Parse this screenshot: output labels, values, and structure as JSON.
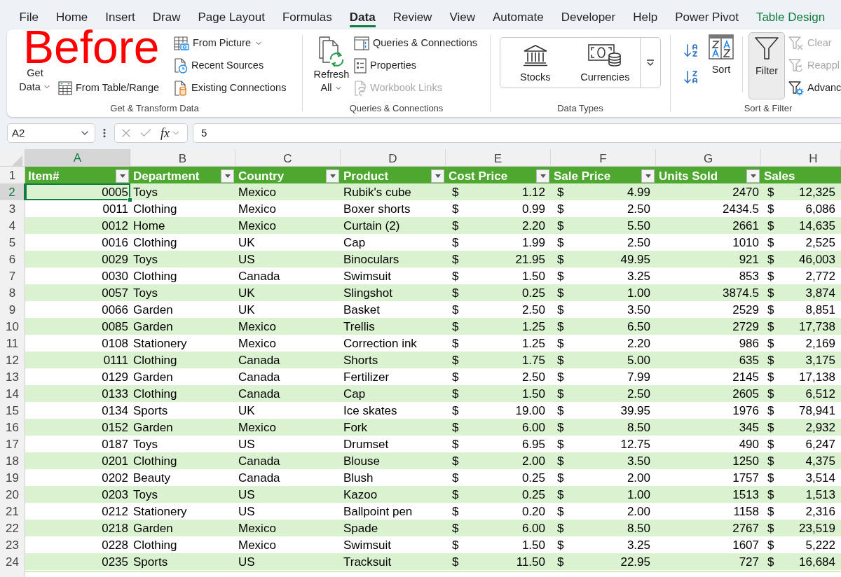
{
  "annotation": {
    "text": "Before"
  },
  "menu_tabs": [
    {
      "label": "File",
      "selected": false,
      "kind": "standard"
    },
    {
      "label": "Home",
      "selected": false,
      "kind": "standard"
    },
    {
      "label": "Insert",
      "selected": false,
      "kind": "standard"
    },
    {
      "label": "Draw",
      "selected": false,
      "kind": "standard"
    },
    {
      "label": "Page Layout",
      "selected": false,
      "kind": "standard"
    },
    {
      "label": "Formulas",
      "selected": false,
      "kind": "standard"
    },
    {
      "label": "Data",
      "selected": true,
      "kind": "standard"
    },
    {
      "label": "Review",
      "selected": false,
      "kind": "standard"
    },
    {
      "label": "View",
      "selected": false,
      "kind": "standard"
    },
    {
      "label": "Automate",
      "selected": false,
      "kind": "standard"
    },
    {
      "label": "Developer",
      "selected": false,
      "kind": "standard"
    },
    {
      "label": "Help",
      "selected": false,
      "kind": "standard"
    },
    {
      "label": "Power Pivot",
      "selected": false,
      "kind": "standard"
    },
    {
      "label": "Table Design",
      "selected": false,
      "kind": "contextual"
    }
  ],
  "ribbon": {
    "get_transform": {
      "label": "Get & Transform Data",
      "get_data": {
        "lines": [
          "Get",
          "Data"
        ]
      },
      "from_table_range": {
        "label": "From Table/Range"
      },
      "from_picture": {
        "label": "From Picture"
      },
      "recent_sources": {
        "label": "Recent Sources"
      },
      "existing_connections": {
        "label": "Existing Connections"
      }
    },
    "queries_connections": {
      "label": "Queries & Connections",
      "refresh_all": {
        "lines": [
          "Refresh",
          "All"
        ]
      },
      "items": [
        {
          "label": "Queries & Connections",
          "disabled": false
        },
        {
          "label": "Properties",
          "disabled": false
        },
        {
          "label": "Workbook Links",
          "disabled": true
        }
      ]
    },
    "data_types": {
      "label": "Data Types",
      "items": [
        {
          "label": "Stocks"
        },
        {
          "label": "Currencies"
        }
      ]
    },
    "sort_filter": {
      "label": "Sort & Filter",
      "sort": {
        "label": "Sort"
      },
      "filter": {
        "label": "Filter",
        "selected": true
      },
      "items": [
        {
          "label": "Clear",
          "disabled": true
        },
        {
          "label": "Reappl",
          "disabled": true
        },
        {
          "label": "Advanc",
          "disabled": false
        }
      ]
    }
  },
  "formula_bar": {
    "name_box": "A2",
    "function_button": "fx",
    "formula": "5"
  },
  "sheet": {
    "header_row_number": "1",
    "columns": [
      {
        "letter": "A",
        "selected": true,
        "heading": "Item#",
        "kind": "number",
        "filter": true
      },
      {
        "letter": "B",
        "selected": false,
        "heading": "Department",
        "kind": "text",
        "filter": true
      },
      {
        "letter": "C",
        "selected": false,
        "heading": "Country",
        "kind": "text",
        "filter": true
      },
      {
        "letter": "D",
        "selected": false,
        "heading": "Product",
        "kind": "text",
        "filter": true
      },
      {
        "letter": "E",
        "selected": false,
        "heading": "Cost Price",
        "kind": "currency",
        "filter": true
      },
      {
        "letter": "F",
        "selected": false,
        "heading": "Sale Price",
        "kind": "currency",
        "filter": true
      },
      {
        "letter": "G",
        "selected": false,
        "heading": "Units Sold",
        "kind": "number",
        "filter": true
      },
      {
        "letter": "H",
        "selected": false,
        "heading": "Sales",
        "kind": "currency"
      }
    ],
    "rows": [
      {
        "number": "2",
        "selected": true,
        "cells": [
          "0005",
          "Toys",
          "Mexico",
          "Rubik's cube",
          [
            "$",
            "1.12"
          ],
          [
            "$",
            "4.99"
          ],
          "2470",
          [
            "$",
            "12,325"
          ]
        ]
      },
      {
        "number": "3",
        "selected": false,
        "cells": [
          "0011",
          "Clothing",
          "Mexico",
          "Boxer shorts",
          [
            "$",
            "0.99"
          ],
          [
            "$",
            "2.50"
          ],
          "2434.5",
          [
            "$",
            "6,086"
          ]
        ]
      },
      {
        "number": "4",
        "selected": false,
        "cells": [
          "0012",
          "Home",
          "Mexico",
          "Curtain (2)",
          [
            "$",
            "2.20"
          ],
          [
            "$",
            "5.50"
          ],
          "2661",
          [
            "$",
            "14,635"
          ]
        ]
      },
      {
        "number": "5",
        "selected": false,
        "cells": [
          "0016",
          "Clothing",
          "UK",
          "Cap",
          [
            "$",
            "1.99"
          ],
          [
            "$",
            "2.50"
          ],
          "1010",
          [
            "$",
            "2,525"
          ]
        ]
      },
      {
        "number": "6",
        "selected": false,
        "cells": [
          "0029",
          "Toys",
          "US",
          "Binoculars",
          [
            "$",
            "21.95"
          ],
          [
            "$",
            "49.95"
          ],
          "921",
          [
            "$",
            "46,003"
          ]
        ]
      },
      {
        "number": "7",
        "selected": false,
        "cells": [
          "0030",
          "Clothing",
          "Canada",
          "Swimsuit",
          [
            "$",
            "1.50"
          ],
          [
            "$",
            "3.25"
          ],
          "853",
          [
            "$",
            "2,772"
          ]
        ]
      },
      {
        "number": "8",
        "selected": false,
        "cells": [
          "0057",
          "Toys",
          "UK",
          "Slingshot",
          [
            "$",
            "0.25"
          ],
          [
            "$",
            "1.00"
          ],
          "3874.5",
          [
            "$",
            "3,874"
          ]
        ]
      },
      {
        "number": "9",
        "selected": false,
        "cells": [
          "0066",
          "Garden",
          "UK",
          "Basket",
          [
            "$",
            "2.50"
          ],
          [
            "$",
            "3.50"
          ],
          "2529",
          [
            "$",
            "8,851"
          ]
        ]
      },
      {
        "number": "10",
        "selected": false,
        "cells": [
          "0085",
          "Garden",
          "Mexico",
          "Trellis",
          [
            "$",
            "1.25"
          ],
          [
            "$",
            "6.50"
          ],
          "2729",
          [
            "$",
            "17,738"
          ]
        ]
      },
      {
        "number": "11",
        "selected": false,
        "cells": [
          "0108",
          "Stationery",
          "Mexico",
          "Correction ink",
          [
            "$",
            "1.25"
          ],
          [
            "$",
            "2.20"
          ],
          "986",
          [
            "$",
            "2,169"
          ]
        ]
      },
      {
        "number": "12",
        "selected": false,
        "cells": [
          "0111",
          "Clothing",
          "Canada",
          "Shorts",
          [
            "$",
            "1.75"
          ],
          [
            "$",
            "5.00"
          ],
          "635",
          [
            "$",
            "3,175"
          ]
        ]
      },
      {
        "number": "13",
        "selected": false,
        "cells": [
          "0129",
          "Garden",
          "Canada",
          "Fertilizer",
          [
            "$",
            "2.50"
          ],
          [
            "$",
            "7.99"
          ],
          "2145",
          [
            "$",
            "17,138"
          ]
        ]
      },
      {
        "number": "14",
        "selected": false,
        "cells": [
          "0133",
          "Clothing",
          "Canada",
          "Cap",
          [
            "$",
            "1.50"
          ],
          [
            "$",
            "2.50"
          ],
          "2605",
          [
            "$",
            "6,512"
          ]
        ]
      },
      {
        "number": "15",
        "selected": false,
        "cells": [
          "0134",
          "Sports",
          "UK",
          "Ice skates",
          [
            "$",
            "19.00"
          ],
          [
            "$",
            "39.95"
          ],
          "1976",
          [
            "$",
            "78,941"
          ]
        ]
      },
      {
        "number": "16",
        "selected": false,
        "cells": [
          "0152",
          "Garden",
          "Mexico",
          "Fork",
          [
            "$",
            "6.00"
          ],
          [
            "$",
            "8.50"
          ],
          "345",
          [
            "$",
            "2,932"
          ]
        ]
      },
      {
        "number": "17",
        "selected": false,
        "cells": [
          "0187",
          "Toys",
          "US",
          "Drumset",
          [
            "$",
            "6.95"
          ],
          [
            "$",
            "12.75"
          ],
          "490",
          [
            "$",
            "6,247"
          ]
        ]
      },
      {
        "number": "18",
        "selected": false,
        "cells": [
          "0201",
          "Clothing",
          "Canada",
          "Blouse",
          [
            "$",
            "2.00"
          ],
          [
            "$",
            "3.50"
          ],
          "1250",
          [
            "$",
            "4,375"
          ]
        ]
      },
      {
        "number": "19",
        "selected": false,
        "cells": [
          "0202",
          "Beauty",
          "Canada",
          "Blush",
          [
            "$",
            "0.25"
          ],
          [
            "$",
            "2.00"
          ],
          "1757",
          [
            "$",
            "3,514"
          ]
        ]
      },
      {
        "number": "20",
        "selected": false,
        "cells": [
          "0203",
          "Toys",
          "US",
          "Kazoo",
          [
            "$",
            "0.25"
          ],
          [
            "$",
            "1.00"
          ],
          "1513",
          [
            "$",
            "1,513"
          ]
        ]
      },
      {
        "number": "21",
        "selected": false,
        "cells": [
          "0212",
          "Stationery",
          "US",
          "Ballpoint pen",
          [
            "$",
            "0.20"
          ],
          [
            "$",
            "2.00"
          ],
          "1158",
          [
            "$",
            "2,316"
          ]
        ]
      },
      {
        "number": "22",
        "selected": false,
        "cells": [
          "0218",
          "Garden",
          "Mexico",
          "Spade",
          [
            "$",
            "6.00"
          ],
          [
            "$",
            "8.50"
          ],
          "2767",
          [
            "$",
            "23,519"
          ]
        ]
      },
      {
        "number": "23",
        "selected": false,
        "cells": [
          "0228",
          "Clothing",
          "Mexico",
          "Swimsuit",
          [
            "$",
            "1.50"
          ],
          [
            "$",
            "3.25"
          ],
          "1607",
          [
            "$",
            "5,222"
          ]
        ]
      },
      {
        "number": "24",
        "selected": false,
        "cells": [
          "0235",
          "Sports",
          "US",
          "Tracksuit",
          [
            "$",
            "11.50"
          ],
          [
            "$",
            "22.95"
          ],
          "727",
          [
            "$",
            "16,684"
          ]
        ]
      }
    ]
  }
}
